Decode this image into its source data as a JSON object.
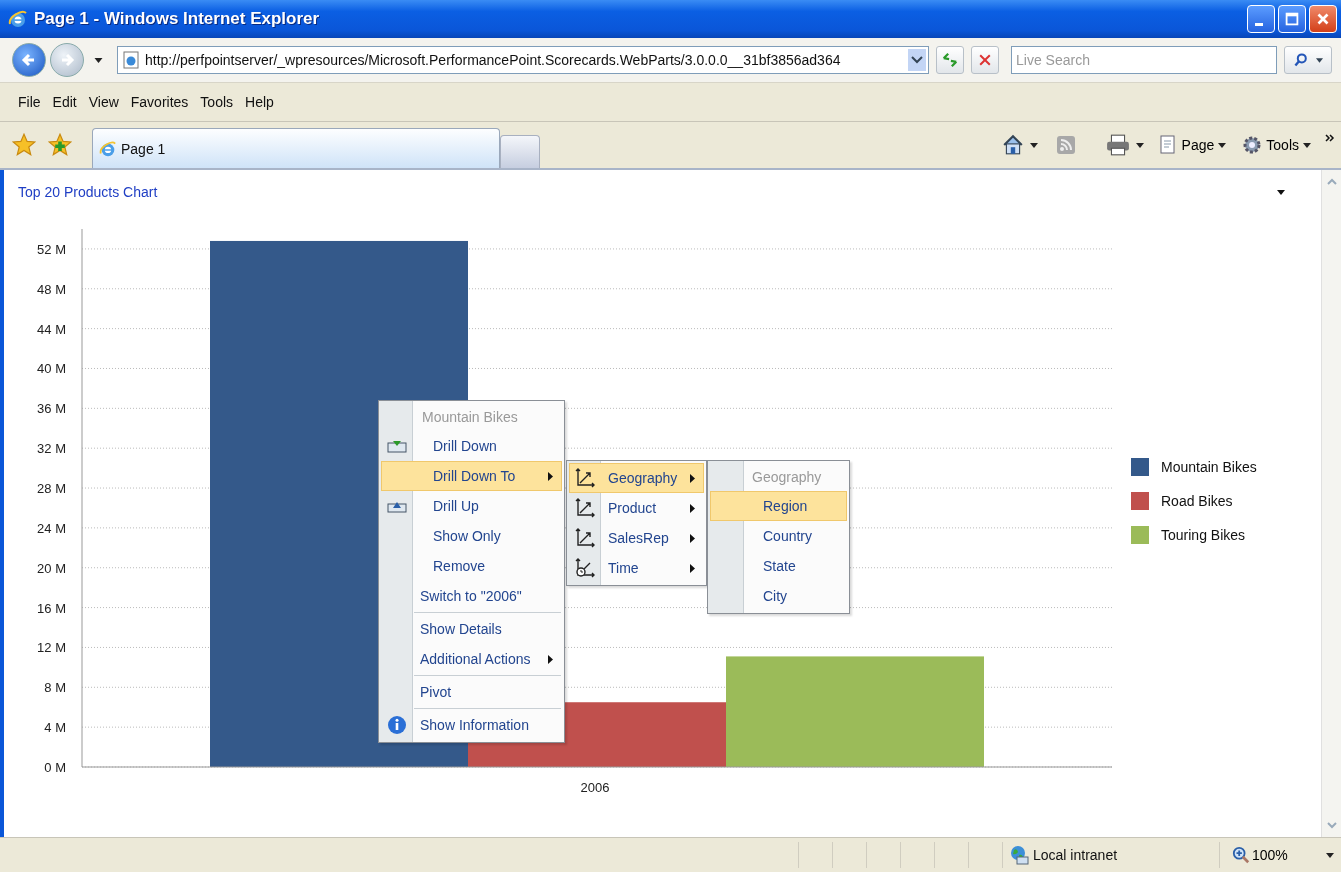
{
  "window": {
    "title": "Page 1 - Windows Internet Explorer"
  },
  "address_bar": {
    "url": "http://perfpointserver/_wpresources/Microsoft.PerformancePoint.Scorecards.WebParts/3.0.0.0__31bf3856ad364"
  },
  "search": {
    "placeholder": "Live Search"
  },
  "menu_bar": [
    "File",
    "Edit",
    "View",
    "Favorites",
    "Tools",
    "Help"
  ],
  "tabs": [
    {
      "label": "Page 1",
      "selected": true
    }
  ],
  "command_bar": [
    "Page",
    "Tools"
  ],
  "report": {
    "title": "Top 20 Products Chart",
    "chart_data": {
      "type": "bar",
      "categories": [
        "2006"
      ],
      "series": [
        {
          "name": "Mountain Bikes",
          "color": "#34598a",
          "values": [
            52.8
          ]
        },
        {
          "name": "Road Bikes",
          "color": "#c0504d",
          "values": [
            6.5
          ]
        },
        {
          "name": "Touring Bikes",
          "color": "#9bbb59",
          "values": [
            11.1
          ]
        }
      ],
      "ylim": [
        0,
        54
      ],
      "grid": true,
      "legend": true,
      "yticks": [
        {
          "value": 0,
          "label": "0 M"
        },
        {
          "value": 4,
          "label": "4 M"
        },
        {
          "value": 8,
          "label": "8 M"
        },
        {
          "value": 12,
          "label": "12 M"
        },
        {
          "value": 16,
          "label": "16 M"
        },
        {
          "value": 20,
          "label": "20 M"
        },
        {
          "value": 24,
          "label": "24 M"
        },
        {
          "value": 28,
          "label": "28 M"
        },
        {
          "value": 32,
          "label": "32 M"
        },
        {
          "value": 36,
          "label": "36 M"
        },
        {
          "value": 40,
          "label": "40 M"
        },
        {
          "value": 44,
          "label": "44 M"
        },
        {
          "value": 48,
          "label": "48 M"
        },
        {
          "value": 52,
          "label": "52 M"
        }
      ]
    }
  },
  "context_menu": {
    "header": "Mountain Bikes",
    "items": [
      {
        "label": "Drill Down",
        "kind": "down",
        "selected": false,
        "has_submenu": false,
        "separator_before": false
      },
      {
        "label": "Drill Down To",
        "kind": "indent",
        "selected": true,
        "has_submenu": true,
        "separator_before": false
      },
      {
        "label": "Drill Up",
        "kind": "up",
        "selected": false,
        "has_submenu": false,
        "separator_before": false
      },
      {
        "label": "Show Only",
        "kind": "indent",
        "selected": false,
        "has_submenu": false,
        "separator_before": false
      },
      {
        "label": "Remove",
        "kind": "indent",
        "selected": false,
        "has_submenu": false,
        "separator_before": false
      },
      {
        "label": "Switch to \"2006\"",
        "kind": "plain",
        "selected": false,
        "has_submenu": false,
        "separator_before": false
      },
      {
        "label": "Show Details",
        "kind": "plain",
        "selected": false,
        "has_submenu": false,
        "separator_before": true
      },
      {
        "label": "Additional Actions",
        "kind": "plain",
        "selected": false,
        "has_submenu": true,
        "separator_before": false
      },
      {
        "label": "Pivot",
        "kind": "plain",
        "selected": false,
        "has_submenu": false,
        "separator_before": true
      },
      {
        "label": "Show Information",
        "kind": "info",
        "selected": false,
        "has_submenu": false,
        "separator_before": true
      }
    ]
  },
  "dimension_menu": {
    "items": [
      {
        "label": "Geography",
        "kind": "axis",
        "selected": true,
        "has_submenu": true
      },
      {
        "label": "Product",
        "kind": "axis",
        "selected": false,
        "has_submenu": true
      },
      {
        "label": "SalesRep",
        "kind": "axis",
        "selected": false,
        "has_submenu": true
      },
      {
        "label": "Time",
        "kind": "clock",
        "selected": false,
        "has_submenu": true
      }
    ]
  },
  "level_menu": {
    "header": "Geography",
    "items": [
      {
        "label": "Region",
        "selected": true
      },
      {
        "label": "Country",
        "selected": false
      },
      {
        "label": "State",
        "selected": false
      },
      {
        "label": "City",
        "selected": false
      }
    ]
  },
  "status_bar": {
    "zone": "Local intranet",
    "zoom": "100%"
  }
}
